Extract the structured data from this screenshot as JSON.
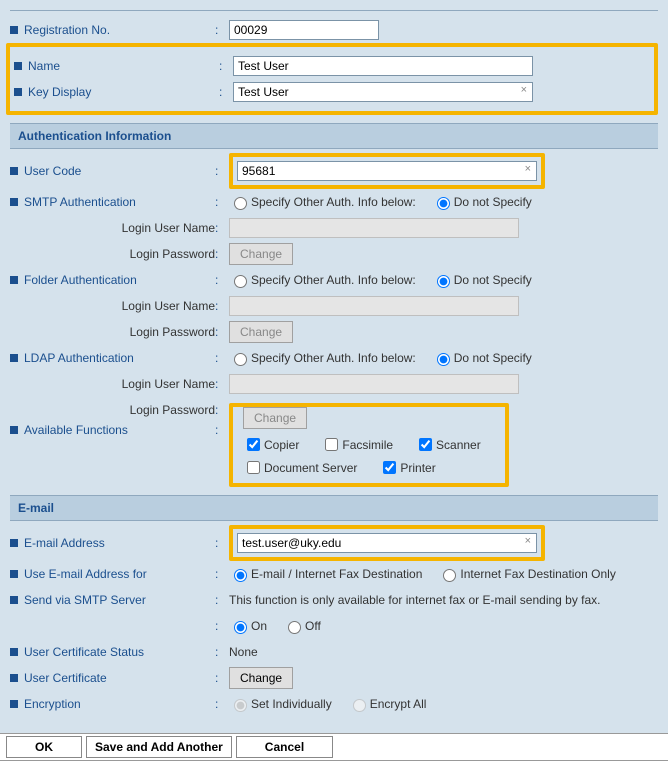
{
  "top": {
    "reg_no_label": "Registration No.",
    "reg_no_value": "00029",
    "name_label": "Name",
    "name_value": "Test User",
    "key_display_label": "Key Display",
    "key_display_value": "Test User"
  },
  "auth": {
    "section_title": "Authentication Information",
    "user_code_label": "User Code",
    "user_code_value": "95681",
    "smtp_label": "SMTP Authentication",
    "folder_label": "Folder Authentication",
    "ldap_label": "LDAP Authentication",
    "login_user_label": "Login User Name",
    "login_pass_label": "Login Password",
    "change_btn": "Change",
    "radio_specify": "Specify Other Auth. Info below:",
    "radio_dont": "Do not Specify",
    "available_label": "Available Functions",
    "fn_copier": "Copier",
    "fn_fax": "Facsimile",
    "fn_scanner": "Scanner",
    "fn_docserver": "Document Server",
    "fn_printer": "Printer"
  },
  "email": {
    "section_title": "E-mail",
    "addr_label": "E-mail Address",
    "addr_value": "test.user@uky.edu",
    "use_for_label": "Use E-mail Address for",
    "use_for_opt1": "E-mail / Internet Fax Destination",
    "use_for_opt2": "Internet Fax Destination Only",
    "send_via_label": "Send via SMTP Server",
    "send_note": "This function is only available for internet fax or E-mail sending by fax.",
    "on_label": "On",
    "off_label": "Off",
    "cert_status_label": "User Certificate Status",
    "cert_status_value": "None",
    "cert_label": "User Certificate",
    "change_btn": "Change",
    "encryption_label": "Encryption",
    "enc_opt1": "Set Individually",
    "enc_opt2": "Encrypt All"
  },
  "footer": {
    "ok": "OK",
    "save_add": "Save and Add Another",
    "cancel": "Cancel"
  }
}
